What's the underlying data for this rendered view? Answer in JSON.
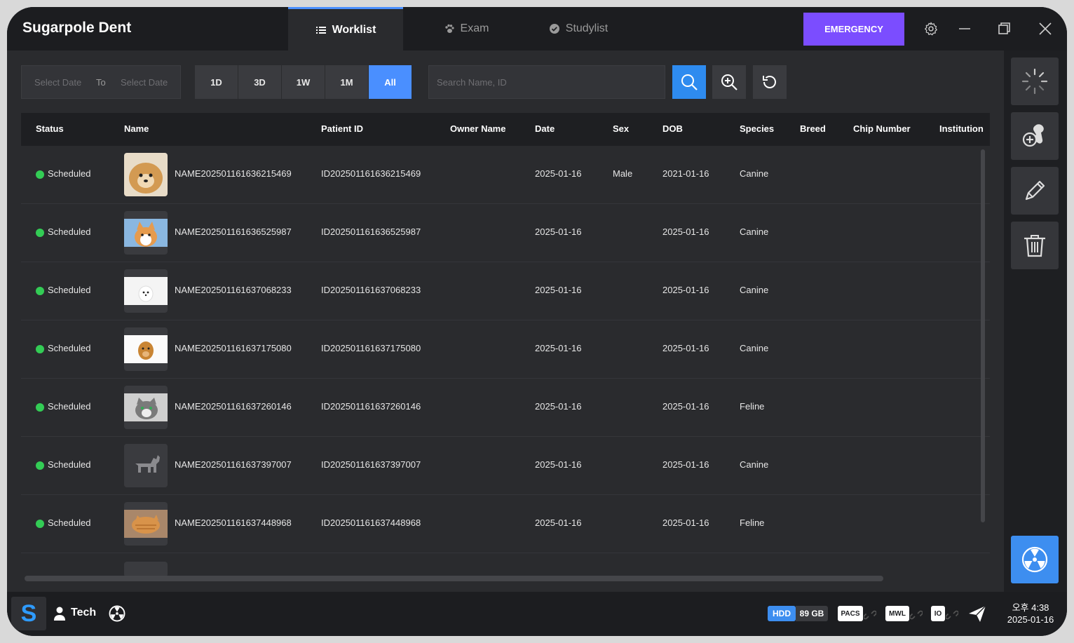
{
  "app": {
    "title": "Sugarpole Dent",
    "tabs": [
      {
        "label": "Worklist",
        "icon": "list-icon",
        "active": true
      },
      {
        "label": "Exam",
        "icon": "paw-icon",
        "active": false
      },
      {
        "label": "Studylist",
        "icon": "check-circle-icon",
        "active": false
      }
    ],
    "emergency_label": "EMERGENCY"
  },
  "filters": {
    "date_from_placeholder": "Select Date",
    "to_label": "To",
    "date_to_placeholder": "Select Date",
    "ranges": [
      "1D",
      "3D",
      "1W",
      "1M",
      "All"
    ],
    "active_range": "All",
    "search_placeholder": "Search Name, ID"
  },
  "table": {
    "columns": [
      "Status",
      "Name",
      "Patient ID",
      "Owner Name",
      "Date",
      "Sex",
      "DOB",
      "Species",
      "Breed",
      "Chip Number",
      "Institution"
    ],
    "rows": [
      {
        "status": "Scheduled",
        "name": "NAME202501161636215469",
        "patient_id": "ID202501161636215469",
        "owner": "",
        "date": "2025-01-16",
        "sex": "Male",
        "dob": "2021-01-16",
        "species": "Canine",
        "breed": "",
        "chip": "",
        "institution": "",
        "thumb": "pomeranian"
      },
      {
        "status": "Scheduled",
        "name": "NAME202501161636525987",
        "patient_id": "ID202501161636525987",
        "owner": "",
        "date": "2025-01-16",
        "sex": "",
        "dob": "2025-01-16",
        "species": "Canine",
        "breed": "",
        "chip": "",
        "institution": "",
        "thumb": "corgi"
      },
      {
        "status": "Scheduled",
        "name": "NAME202501161637068233",
        "patient_id": "ID202501161637068233",
        "owner": "",
        "date": "2025-01-16",
        "sex": "",
        "dob": "2025-01-16",
        "species": "Canine",
        "breed": "",
        "chip": "",
        "institution": "",
        "thumb": "white-dog"
      },
      {
        "status": "Scheduled",
        "name": "NAME202501161637175080",
        "patient_id": "ID202501161637175080",
        "owner": "",
        "date": "2025-01-16",
        "sex": "",
        "dob": "2025-01-16",
        "species": "Canine",
        "breed": "",
        "chip": "",
        "institution": "",
        "thumb": "golden"
      },
      {
        "status": "Scheduled",
        "name": "NAME202501161637260146",
        "patient_id": "ID202501161637260146",
        "owner": "",
        "date": "2025-01-16",
        "sex": "",
        "dob": "2025-01-16",
        "species": "Feline",
        "breed": "",
        "chip": "",
        "institution": "",
        "thumb": "tabby-cat"
      },
      {
        "status": "Scheduled",
        "name": "NAME202501161637397007",
        "patient_id": "ID202501161637397007",
        "owner": "",
        "date": "2025-01-16",
        "sex": "",
        "dob": "2025-01-16",
        "species": "Canine",
        "breed": "",
        "chip": "",
        "institution": "",
        "thumb": "placeholder"
      },
      {
        "status": "Scheduled",
        "name": "NAME202501161637448968",
        "patient_id": "ID202501161637448968",
        "owner": "",
        "date": "2025-01-16",
        "sex": "",
        "dob": "2025-01-16",
        "species": "Feline",
        "breed": "",
        "chip": "",
        "institution": "",
        "thumb": "orange-cat"
      }
    ]
  },
  "sidebar": {
    "buttons": [
      "loading-icon",
      "add-patient-icon",
      "edit-icon",
      "trash-icon"
    ],
    "bottom_button": "radiation-icon"
  },
  "statusbar": {
    "logo": "S",
    "user": "Tech",
    "hdd_label": "HDD",
    "hdd_value": "89 GB",
    "pacs_label": "PACS",
    "mwl_label": "MWL",
    "io_label": "IO",
    "time": "오후 4:38",
    "date": "2025-01-16"
  },
  "colors": {
    "accent": "#4a8fff",
    "emergency": "#7b4dff",
    "status_ok": "#33cc55"
  }
}
